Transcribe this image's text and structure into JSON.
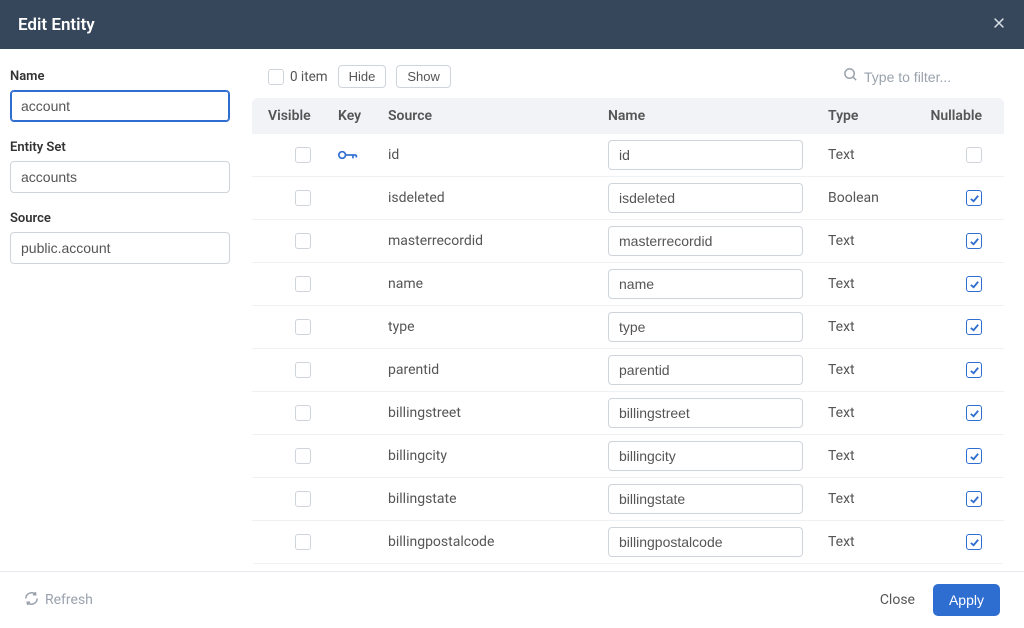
{
  "header": {
    "title": "Edit Entity"
  },
  "form": {
    "name_label": "Name",
    "name_value": "account",
    "entityset_label": "Entity Set",
    "entityset_value": "accounts",
    "source_label": "Source",
    "source_value": "public.account"
  },
  "toolbar": {
    "count_label": "0 item",
    "hide_label": "Hide",
    "show_label": "Show",
    "filter_placeholder": "Type to filter..."
  },
  "table": {
    "headers": {
      "visible": "Visible",
      "key": "Key",
      "source": "Source",
      "name": "Name",
      "type": "Type",
      "nullable": "Nullable"
    },
    "rows": [
      {
        "source": "id",
        "name": "id",
        "type": "Text",
        "isKey": true,
        "nullable": false
      },
      {
        "source": "isdeleted",
        "name": "isdeleted",
        "type": "Boolean",
        "isKey": false,
        "nullable": true
      },
      {
        "source": "masterrecordid",
        "name": "masterrecordid",
        "type": "Text",
        "isKey": false,
        "nullable": true
      },
      {
        "source": "name",
        "name": "name",
        "type": "Text",
        "isKey": false,
        "nullable": true
      },
      {
        "source": "type",
        "name": "type",
        "type": "Text",
        "isKey": false,
        "nullable": true
      },
      {
        "source": "parentid",
        "name": "parentid",
        "type": "Text",
        "isKey": false,
        "nullable": true
      },
      {
        "source": "billingstreet",
        "name": "billingstreet",
        "type": "Text",
        "isKey": false,
        "nullable": true
      },
      {
        "source": "billingcity",
        "name": "billingcity",
        "type": "Text",
        "isKey": false,
        "nullable": true
      },
      {
        "source": "billingstate",
        "name": "billingstate",
        "type": "Text",
        "isKey": false,
        "nullable": true
      },
      {
        "source": "billingpostalcode",
        "name": "billingpostalcode",
        "type": "Text",
        "isKey": false,
        "nullable": true
      }
    ]
  },
  "footer": {
    "refresh_label": "Refresh",
    "close_label": "Close",
    "apply_label": "Apply"
  }
}
